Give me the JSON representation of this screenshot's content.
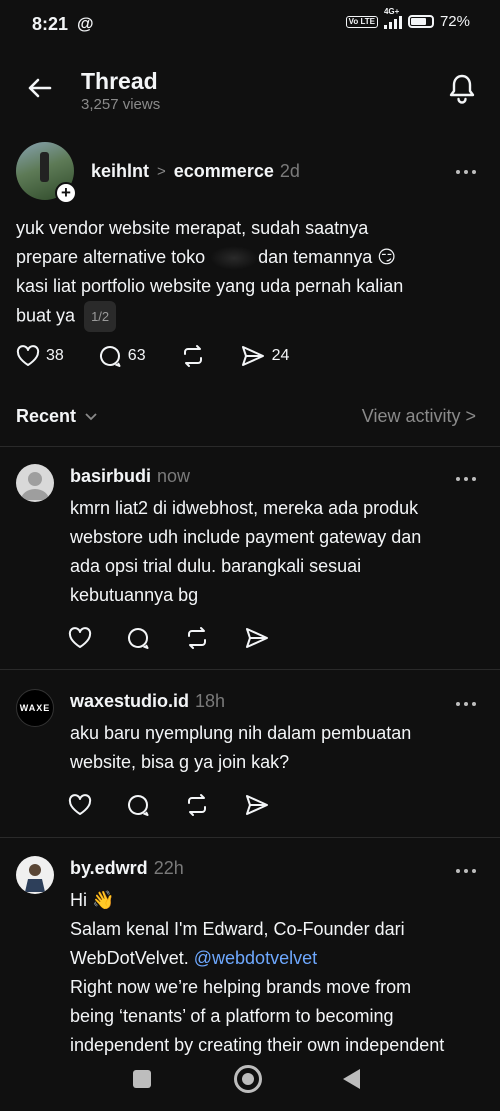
{
  "status": {
    "time": "8:21",
    "app_glyph": "@",
    "volte": "Vo LTE",
    "network": "4G+",
    "battery": "72%"
  },
  "header": {
    "title": "Thread",
    "views": "3,257 views"
  },
  "post": {
    "username": "keihlnt",
    "separator": ">",
    "topic": "ecommerce",
    "time": "2d",
    "text_line1": "yuk vendor website merapat, sudah saatnya",
    "text_line2a": "prepare alternative toko",
    "text_line2b": "dan temannya 😏",
    "text_line3": "kasi liat portfolio website yang uda pernah kalian",
    "text_line4": "buat ya",
    "pager": "1/2",
    "likes": "38",
    "comments": "63",
    "shares": "24"
  },
  "recent": {
    "label": "Recent",
    "view_activity": "View activity >"
  },
  "replies": [
    {
      "username": "basirbudi",
      "time": "now",
      "lines": [
        "kmrn liat2 di idwebhost, mereka ada produk",
        "webstore udh include payment gateway dan",
        "ada opsi trial dulu. barangkali sesuai",
        "kebutuannya bg"
      ]
    },
    {
      "username": "waxestudio.id",
      "time": "18h",
      "avatar_text": "WAXE",
      "lines": [
        "aku baru nyemplung nih dalam pembuatan",
        "website, bisa g ya join kak?"
      ]
    },
    {
      "username": "by.edwrd",
      "time": "22h",
      "line1": "Hi 👋",
      "line2": "Salam kenal I'm Edward, Co-Founder dari",
      "line3a": "WebDotVelvet.",
      "line3b": "@webdotvelvet",
      "line4": "Right now we’re helping brands move from",
      "line5": "being ‘tenants’ of a platform to becoming",
      "line6": "independent by creating their own independent"
    }
  ],
  "icons": {
    "back": "back-arrow-icon",
    "bell": "bell-icon",
    "more": "more-horizontal-icon",
    "like": "heart-icon",
    "comment": "comment-bubble-icon",
    "repost": "repost-icon",
    "share": "send-icon"
  },
  "colors": {
    "background": "#101010",
    "text": "#f3f5f7",
    "muted": "#8a8a8a",
    "mention": "#6ea8fe",
    "divider": "#2a2a2a"
  }
}
